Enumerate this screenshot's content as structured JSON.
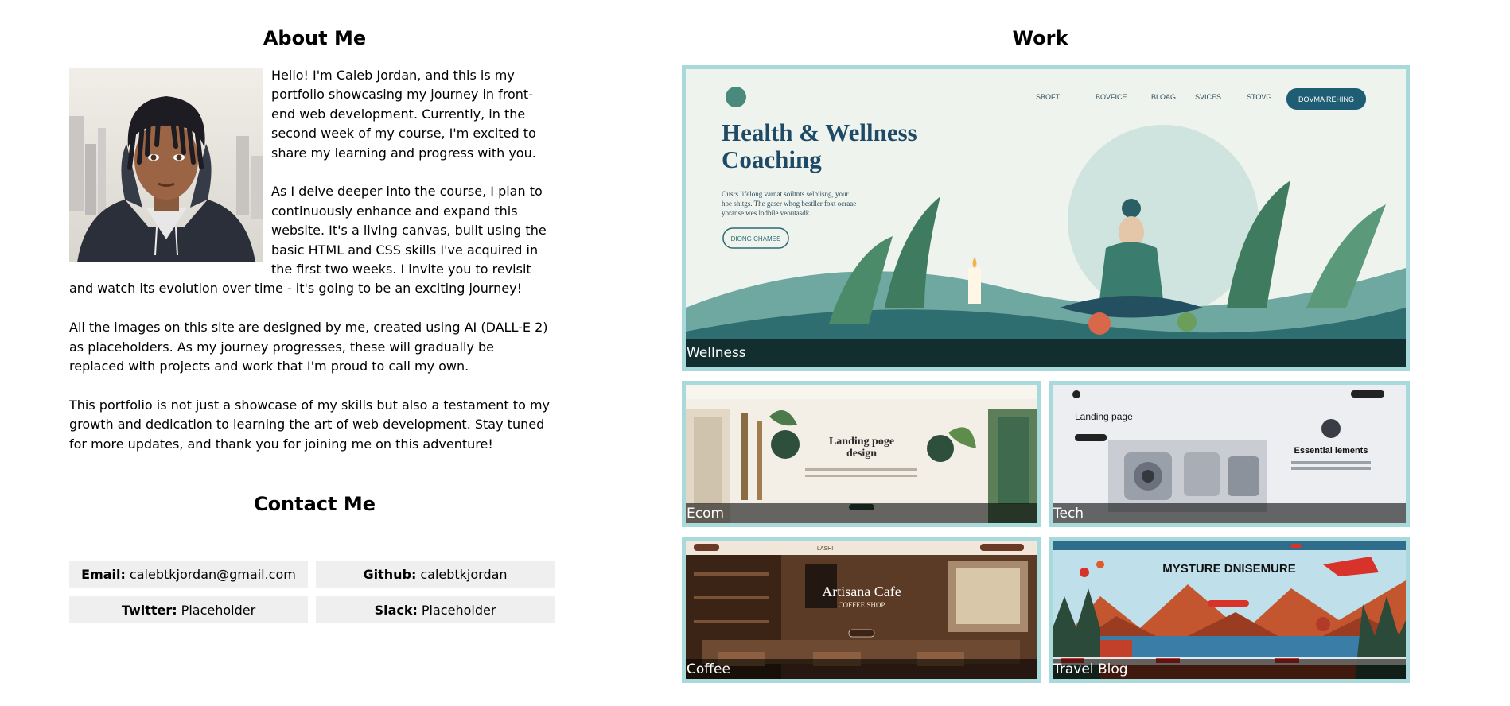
{
  "about": {
    "title": "About Me",
    "paragraphs": [
      "Hello! I'm Caleb Jordan, and this is my portfolio showcasing my journey in front-end web development. Currently, in the second week of my course, I'm excited to share my learning and progress with you.",
      "As I delve deeper into the course, I plan to continuously enhance and expand this website. It's a living canvas, built using the basic HTML and CSS skills I've acquired in the first two weeks. I invite you to revisit and watch its evolution over time - it's going to be an exciting journey!",
      "All the images on this site are designed by me, created using AI (DALL-E 2) as placeholders. As my journey progresses, these will gradually be replaced with projects and work that I'm proud to call my own.",
      "This portfolio is not just a showcase of my skills but also a testament to my growth and dedication to learning the art of web development. Stay tuned for more updates, and thank you for joining me on this adventure!"
    ]
  },
  "contact": {
    "title": "Contact Me",
    "email": {
      "label": "Email:",
      "value": "calebtkjordan@gmail.com"
    },
    "github": {
      "label": "Github:",
      "value": "calebtkjordan"
    },
    "twitter": {
      "label": "Twitter:",
      "value": "Placeholder"
    },
    "slack": {
      "label": "Slack:",
      "value": "Placeholder"
    }
  },
  "work": {
    "title": "Work",
    "tiles": [
      {
        "caption": "Wellness",
        "image_heading": "Health & Wellness Coaching",
        "image_nav": [
          "SBOFT",
          "BOVFICE",
          "BLOAG",
          "SVICES",
          "STOVG"
        ],
        "image_button": "DOVMA REHING",
        "image_cta": "DIONG CHAMES",
        "image_text": "Ousrs lifelong varnat soiltnts selbiisng, your hoe shitgs. The gaser whog bestller foxt ocraae yoranse wes lodbile veoutasdk."
      },
      {
        "caption": "Ecom",
        "image_heading": "Landing poge design"
      },
      {
        "caption": "Tech",
        "image_heading": "Landing page",
        "image_subheading": "Essential lements"
      },
      {
        "caption": "Coffee",
        "image_heading": "Artisana Cafe",
        "image_subheading": "COFFEE SHOP",
        "image_logo": "LASHI"
      },
      {
        "caption": "Travel Blog",
        "image_heading": "MYSTURE DNISEMURE"
      }
    ]
  },
  "colors": {
    "tile_border": "#a8dadc",
    "contact_bg": "#efefef",
    "caption_overlay": "rgba(0,0,0,0.58)"
  },
  "icons": {
    "avatar": "illustrated-portrait",
    "wellness_logo": "leaf-circle-icon"
  }
}
